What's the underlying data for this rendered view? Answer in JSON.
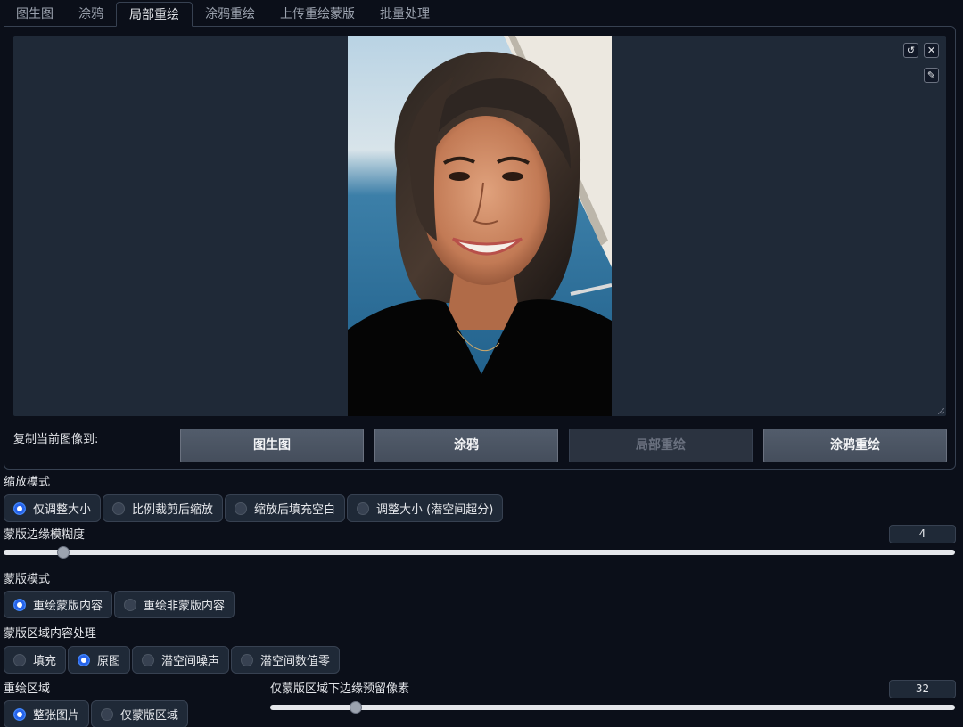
{
  "tabs": [
    {
      "label": "图生图",
      "active": false
    },
    {
      "label": "涂鸦",
      "active": false
    },
    {
      "label": "局部重绘",
      "active": true
    },
    {
      "label": "涂鸦重绘",
      "active": false
    },
    {
      "label": "上传重绘蒙版",
      "active": false
    },
    {
      "label": "批量处理",
      "active": false
    }
  ],
  "canvas": {
    "undo_icon": "undo-icon",
    "close_icon": "close-icon",
    "brush_icon": "brush-icon"
  },
  "copy": {
    "label": "复制当前图像到:",
    "buttons": [
      "图生图",
      "涂鸦",
      "局部重绘",
      "涂鸦重绘"
    ]
  },
  "resize_mode": {
    "label": "缩放模式",
    "options": [
      "仅调整大小",
      "比例裁剪后缩放",
      "缩放后填充空白",
      "调整大小 (潜空间超分)"
    ],
    "selected": 0
  },
  "mask_blur": {
    "label": "蒙版边缘模糊度",
    "value": "4",
    "fraction": 0.0625
  },
  "mask_mode": {
    "label": "蒙版模式",
    "options": [
      "重绘蒙版内容",
      "重绘非蒙版内容"
    ],
    "selected": 0
  },
  "masked_content": {
    "label": "蒙版区域内容处理",
    "options": [
      "填充",
      "原图",
      "潜空间噪声",
      "潜空间数值零"
    ],
    "selected": 1
  },
  "inpaint_area": {
    "label": "重绘区域",
    "options": [
      "整张图片",
      "仅蒙版区域"
    ],
    "selected": 0
  },
  "padding": {
    "label": "仅蒙版区域下边缘预留像素",
    "value": "32",
    "fraction": 0.125
  },
  "colors": {
    "accent": "#2563eb",
    "background": "#0b0f19",
    "panel": "#1f2937"
  }
}
